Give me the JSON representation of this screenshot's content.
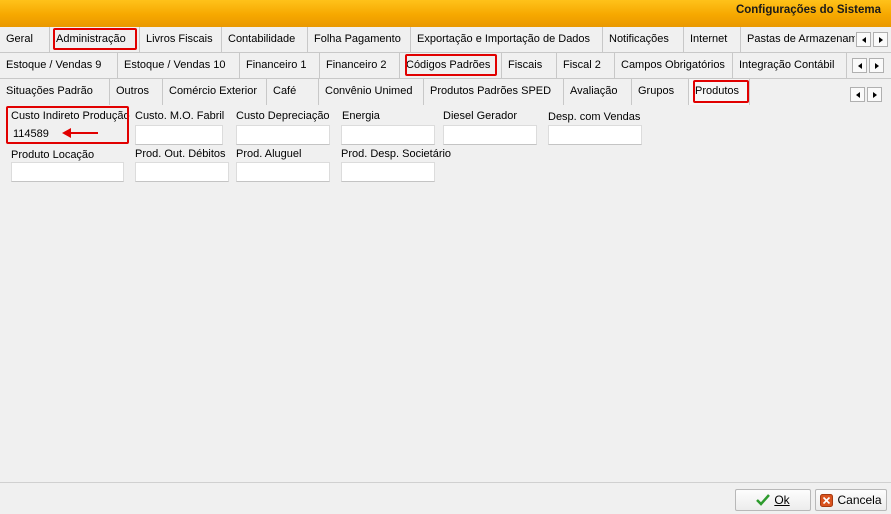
{
  "window": {
    "title": "Configurações do Sistema"
  },
  "tabs_row1": [
    "Geral",
    "Administração",
    "Livros Fiscais",
    "Contabilidade",
    "Folha Pagamento",
    "Exportação e Importação de Dados",
    "Notificações",
    "Internet",
    "Pastas de Armazenam"
  ],
  "tabs_row2": [
    "Estoque / Vendas 9",
    "Estoque / Vendas 10",
    "Financeiro 1",
    "Financeiro 2",
    "Códigos Padrões",
    "Fiscais",
    "Fiscal 2",
    "Campos Obrigatórios",
    "Integração Contábil"
  ],
  "tabs_row3": [
    "Situações Padrão",
    "Outros",
    "Comércio Exterior",
    "Café",
    "Convênio Unimed",
    "Produtos Padrões SPED",
    "Avaliação",
    "Grupos",
    "Produtos"
  ],
  "fields_row1": [
    {
      "label": "Custo Indireto Produção",
      "value": "114589"
    },
    {
      "label": "Custo. M.O. Fabril",
      "value": ""
    },
    {
      "label": "Custo Depreciação",
      "value": ""
    },
    {
      "label": "Energia",
      "value": ""
    },
    {
      "label": "Diesel Gerador",
      "value": ""
    },
    {
      "label": "Desp. com Vendas",
      "value": ""
    }
  ],
  "fields_row2": [
    {
      "label": "Produto Locação",
      "value": ""
    },
    {
      "label": "Prod. Out. Débitos",
      "value": ""
    },
    {
      "label": "Prod. Aluguel",
      "value": ""
    },
    {
      "label": "Prod. Desp. Societário",
      "value": ""
    }
  ],
  "buttons": {
    "ok": "Ok",
    "cancel": "Cancela"
  },
  "colors": {
    "titlebar": "#f6a800",
    "highlight": "#e10000",
    "ok_check": "#2e9b2e",
    "cancel_icon": "#d9531e"
  },
  "icons": {
    "ok": "check-icon",
    "cancel": "cancel-icon",
    "scroll_left": "scroll-left-icon",
    "scroll_right": "scroll-right-icon"
  }
}
